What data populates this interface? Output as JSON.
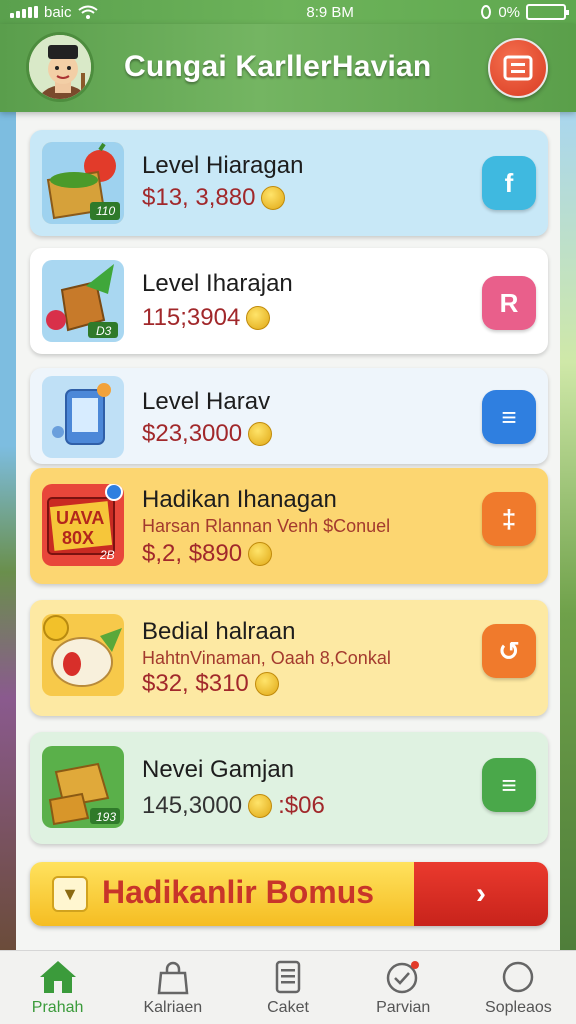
{
  "status_bar": {
    "carrier": "baic",
    "time": "8:9 BM",
    "battery": "0%",
    "battery_level": 0.0
  },
  "header": {
    "title": "Cungai KarllerHavian"
  },
  "items": [
    {
      "name": "Level Hiaragan",
      "price": "$13, 3,880",
      "badge": "110",
      "icon": "basket-icon",
      "action_symbol": "f",
      "bg": "#c8e8f7",
      "action_color": "#3fb9e0"
    },
    {
      "name": "Level Iharajan",
      "price": "115;3904",
      "badge": "D3",
      "icon": "crate-icon",
      "action_symbol": "R",
      "bg": "#ffffff",
      "action_color": "#e95f8b"
    },
    {
      "name": "Level Harav",
      "price": "$23,3000",
      "badge": "",
      "icon": "tablet-icon",
      "action_symbol": "≡",
      "bg": "#eef5fb",
      "action_color": "#2f7fe0"
    },
    {
      "name": "Hadikan Ihanagan",
      "subtitle": "Harsan Rlannan Venh $Conuel",
      "price": "$,2, $890",
      "badge": "2B",
      "icon": "box-icon",
      "box_text_1": "UAVA",
      "box_text_2": "80X",
      "action_symbol": "‡",
      "bg": "#fcd671",
      "action_color": "#f07a2c"
    },
    {
      "name": "Bedial halraan",
      "subtitle": "HahtnVinaman, Oaah 8,Conkal",
      "price": "$32, $310",
      "badge": "",
      "icon": "vegetable-icon",
      "action_symbol": "↺",
      "bg": "#fde9a3",
      "action_color": "#f07a2c"
    },
    {
      "name": "Nevei Gamjan",
      "price": "145,3000",
      "price_suffix": ":$06",
      "badge": "193",
      "icon": "crates-icon",
      "action_symbol": "≡",
      "bg": "#dff2e1",
      "action_color": "#4aa84a"
    }
  ],
  "bonus": {
    "label": "Hadikanlir Bomus",
    "arrow": "›"
  },
  "nav": [
    {
      "label": "Prahah",
      "icon": "home-icon",
      "active": true
    },
    {
      "label": "Kalriaen",
      "icon": "bag-icon",
      "active": false
    },
    {
      "label": "Caket",
      "icon": "receipt-icon",
      "active": false
    },
    {
      "label": "Parvian",
      "icon": "target-icon",
      "active": false
    },
    {
      "label": "Sopleaos",
      "icon": "circle-icon",
      "active": false
    }
  ]
}
